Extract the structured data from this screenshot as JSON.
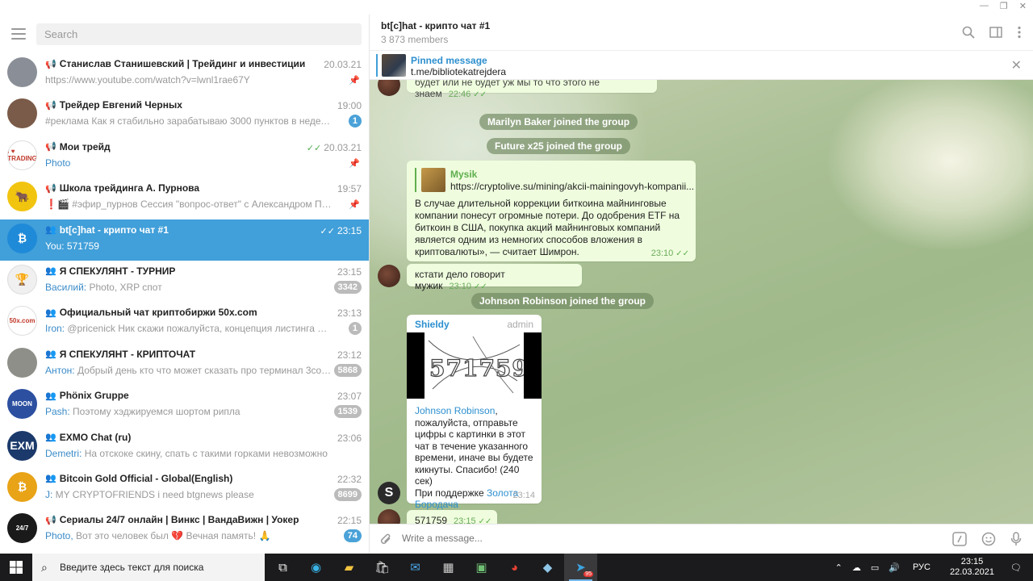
{
  "sidebar": {
    "search_placeholder": "Search",
    "chats": [
      {
        "name": "Станислав Станишевский | Трейдинг и инвестиции",
        "kind": "channel",
        "time": "20.03.21",
        "preview": "https://www.youtube.com/watch?v=lwnl1rae67Y",
        "sender": "",
        "badge": "",
        "pinned": true,
        "avatar_color": "#8a8f97",
        "avatar_text": ""
      },
      {
        "name": "Трейдер Евгений Черных",
        "kind": "channel",
        "time": "19:00",
        "preview": "#реклама  Как я стабильно зарабатываю 3000 пунктов в неделю на Р...",
        "sender": "",
        "badge": "1",
        "badge_style": "blue",
        "pinned": false,
        "avatar_color": "#7a5a48",
        "avatar_text": ""
      },
      {
        "name": "Мои трейд",
        "kind": "channel",
        "time": "20.03.21",
        "preview": "Photo",
        "preview_link": true,
        "sender": "",
        "badge": "",
        "pinned": true,
        "read": true,
        "avatar_color": "#ffffff",
        "avatar_text": "I ♥ TRADING"
      },
      {
        "name": "Школа трейдинга А. Пурнова",
        "kind": "channel",
        "time": "19:57",
        "preview": "❗🎬 #эфир_пурнов Сессия \"вопрос-ответ\" с Александром Пурновы...",
        "sender": "",
        "badge": "",
        "pinned": true,
        "avatar_color": "#f1c40f",
        "avatar_text": "🐂"
      },
      {
        "name": "bt[c]hat - крипто чат #1",
        "kind": "group",
        "time": "23:15",
        "preview": "You: 571759",
        "sender": "",
        "badge": "",
        "active": true,
        "read": true,
        "avatar_color": "#1f8ad8",
        "avatar_text": "₿"
      },
      {
        "name": "Я СПЕКУЛЯНТ - ТУРНИР",
        "kind": "group",
        "time": "23:15",
        "preview": "Photo, XRP спот",
        "sender": "Василий: ",
        "badge": "3342",
        "avatar_color": "#f0f0f0",
        "avatar_text": "🏆"
      },
      {
        "name": "Официальный чат криптобиржи 50x.com",
        "kind": "group",
        "time": "23:13",
        "preview": "@pricenick Ник скажи пожалуйста, концепция листинга новых м...",
        "sender": "Iron: ",
        "badge": "1",
        "avatar_color": "#ffffff",
        "avatar_text": "50x.com"
      },
      {
        "name": "Я СПЕКУЛЯНТ - КРИПТОЧАТ",
        "kind": "group",
        "time": "23:12",
        "preview": "Добрый день кто что может сказать про терминал 3commas ...",
        "sender": "Антон: ",
        "badge": "5868",
        "avatar_color": "#8d8f88",
        "avatar_text": ""
      },
      {
        "name": "Phönix Gruppe",
        "kind": "group",
        "time": "23:07",
        "preview": "Поэтому хэджируемся шортом рипла",
        "sender": "Pash: ",
        "badge": "1539",
        "avatar_color": "#2c4fa0",
        "avatar_text": "MOON"
      },
      {
        "name": "EXMO Chat (ru)",
        "kind": "group",
        "time": "23:06",
        "preview": "На отскоке скину, спать с такими горками невозможно",
        "sender": "Demetri: ",
        "badge": "",
        "avatar_color": "#1b3a6b",
        "avatar_text": "EXM"
      },
      {
        "name": "Bitcoin Gold Official - Global(English)",
        "kind": "group",
        "time": "22:32",
        "preview": "MY CRYPTOFRIENDS i need btgnews please",
        "sender": "J: ",
        "badge": "8699",
        "avatar_color": "#e8a317",
        "avatar_text": "₿"
      },
      {
        "name": "Сериалы 24/7 онлайн | Винкс | ВандаВижн | Уокер",
        "kind": "channel",
        "time": "22:15",
        "preview": "Вот это человек был 💔 Вечная память! 🙏",
        "sender": "Photo, ",
        "badge": "74",
        "badge_style": "blue",
        "avatar_color": "#1a1a1a",
        "avatar_text": "24/7"
      }
    ]
  },
  "header": {
    "title": "bt[c]hat - крипто чат #1",
    "members": "3 873 members"
  },
  "pinned": {
    "label": "Pinned message",
    "text": "t.me/bibliotekatrejdera"
  },
  "messages": {
    "top_fragment": "будет или не будет уж мы то что этого не знаем",
    "top_time": "22:46",
    "service1": "Marilyn Baker joined the group",
    "service2": "Future x25 joined the group",
    "fwd_name": "Mysik",
    "fwd_link": "https://cryptolive.su/mining/akcii-mainingovyh-kompanii...",
    "fwd_text": "В случае длительной коррекции биткоина майнинговые компании понесут огромные потери. До одобрения ETF на биткоин в США, покупка акций майнинговых компаний является одним из немногих способов вложения в криптовалюты», — считает Шимрон.",
    "fwd_time": "23:10",
    "msg2_text": "кстати дело говорит мужик",
    "msg2_time": "23:10",
    "service3": "Johnson Robinson joined the group",
    "bot_name": "Shieldy",
    "bot_role": "admin",
    "captcha_code": "571759",
    "bot_mention": "Johnson Robinson",
    "bot_text": ",\nпожалуйста, отправьте цифры с картинки в этот чат в течение указанного времени, иначе вы будете кикнуты. Спасибо! (240 сек)\nПри поддержке ",
    "bot_link": "Золота Бородача",
    "bot_time": "23:14",
    "my_text": "571759",
    "my_time": "23:15"
  },
  "composer": {
    "placeholder": "Write a message..."
  },
  "taskbar": {
    "search_text": "Введите здесь текст для поиска",
    "lang": "РУС",
    "time": "23:15",
    "date": "22.03.2021",
    "telegram_badge": "95"
  }
}
